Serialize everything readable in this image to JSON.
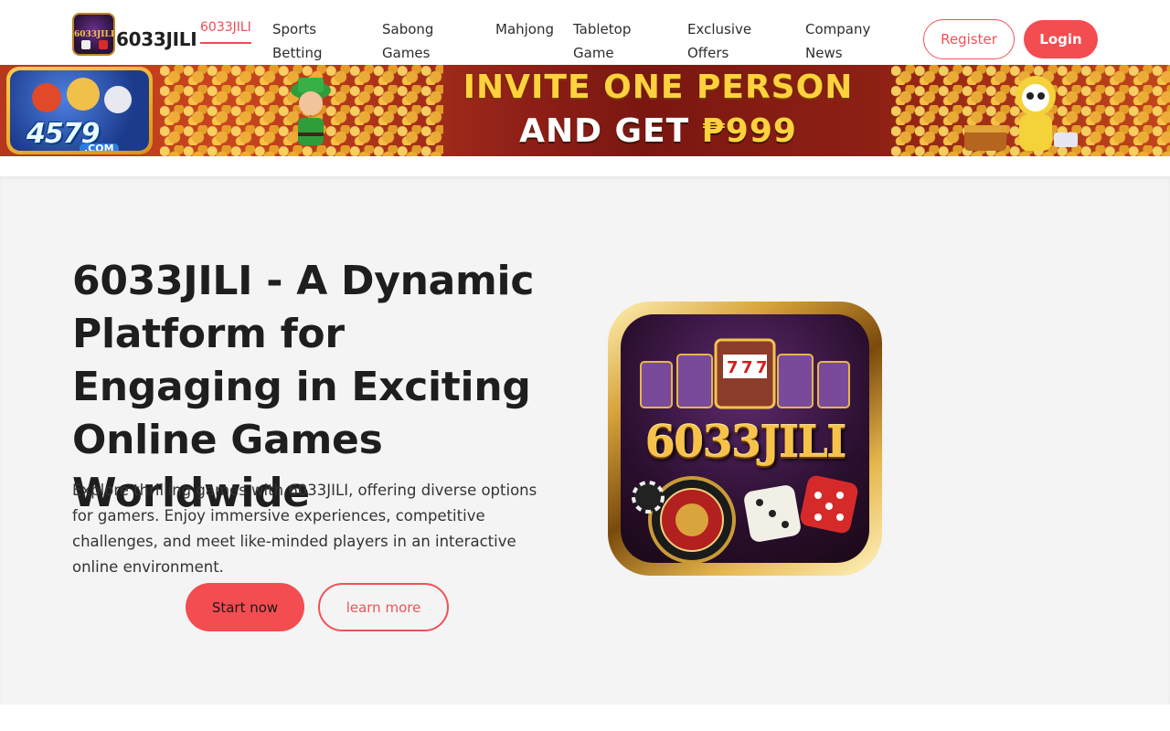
{
  "header": {
    "brand": "6033JILI",
    "nav": [
      {
        "label": "6033JILI",
        "active": true
      },
      {
        "label": "Sports\nBetting"
      },
      {
        "label": "Sabong\nGames"
      },
      {
        "label": "Mahjong"
      },
      {
        "label": "Tabletop\nGame"
      },
      {
        "label": "Exclusive\nOffers"
      },
      {
        "label": "Company\nNews"
      }
    ],
    "register_label": "Register",
    "login_label": "Login"
  },
  "banner": {
    "logo_text": "4579",
    "logo_sub": ".COM",
    "line1": "INVITE ONE PERSON",
    "line2_prefix": "AND GET ",
    "line2_amount": "₱999"
  },
  "hero": {
    "title": "6033JILI - A Dynamic Platform for Engaging in Exciting Online Games Worldwide",
    "description": "Explore thrilling games with 6033JILI, offering diverse options for gamers. Enjoy immersive experiences, competitive challenges, and meet like-minded players in an interactive online environment.",
    "start_label": "Start now",
    "learn_label": "learn more",
    "image_logo_text": "6033JILI"
  },
  "colors": {
    "accent": "#f34c51",
    "hero_bg": "#f4f4f4",
    "text_dark": "#1e1e1e"
  }
}
